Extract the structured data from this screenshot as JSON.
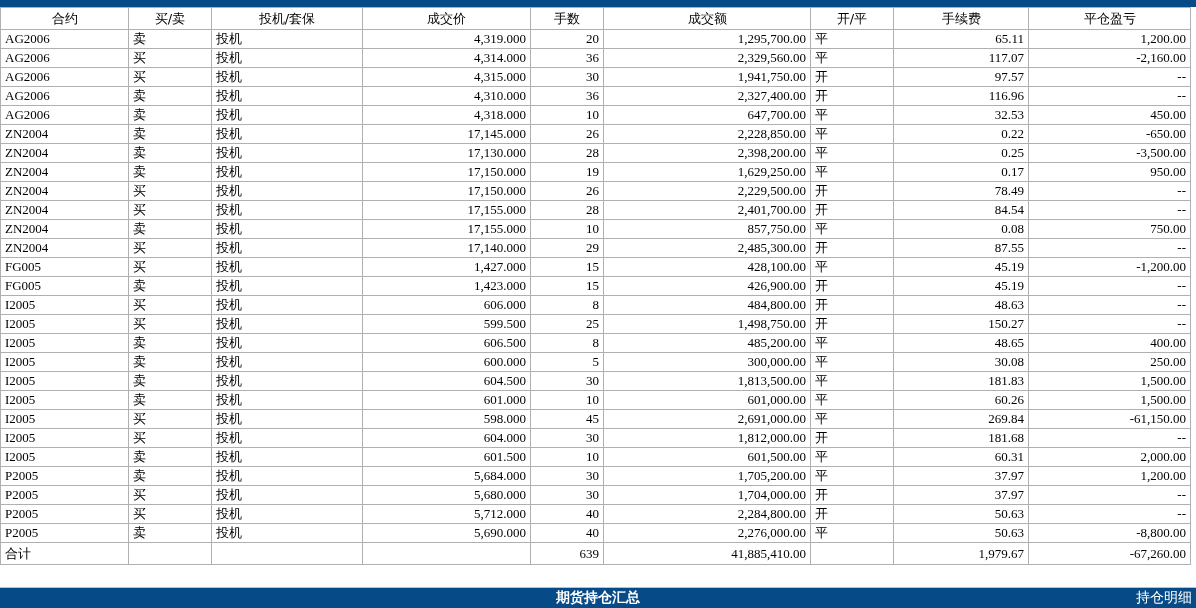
{
  "trades_table": {
    "columns": [
      "合约",
      "买/卖",
      "投机/套保",
      "成交价",
      "手数",
      "成交额",
      "开/平",
      "手续费",
      "平仓盈亏"
    ],
    "rows": [
      [
        "AG2006",
        "卖",
        "投机",
        "4,319.000",
        "20",
        "1,295,700.00",
        "平",
        "65.11",
        "1,200.00"
      ],
      [
        "AG2006",
        "买",
        "投机",
        "4,314.000",
        "36",
        "2,329,560.00",
        "平",
        "117.07",
        "-2,160.00"
      ],
      [
        "AG2006",
        "买",
        "投机",
        "4,315.000",
        "30",
        "1,941,750.00",
        "开",
        "97.57",
        "--"
      ],
      [
        "AG2006",
        "卖",
        "投机",
        "4,310.000",
        "36",
        "2,327,400.00",
        "开",
        "116.96",
        "--"
      ],
      [
        "AG2006",
        "卖",
        "投机",
        "4,318.000",
        "10",
        "647,700.00",
        "平",
        "32.53",
        "450.00"
      ],
      [
        "ZN2004",
        "卖",
        "投机",
        "17,145.000",
        "26",
        "2,228,850.00",
        "平",
        "0.22",
        "-650.00"
      ],
      [
        "ZN2004",
        "卖",
        "投机",
        "17,130.000",
        "28",
        "2,398,200.00",
        "平",
        "0.25",
        "-3,500.00"
      ],
      [
        "ZN2004",
        "卖",
        "投机",
        "17,150.000",
        "19",
        "1,629,250.00",
        "平",
        "0.17",
        "950.00"
      ],
      [
        "ZN2004",
        "买",
        "投机",
        "17,150.000",
        "26",
        "2,229,500.00",
        "开",
        "78.49",
        "--"
      ],
      [
        "ZN2004",
        "买",
        "投机",
        "17,155.000",
        "28",
        "2,401,700.00",
        "开",
        "84.54",
        "--"
      ],
      [
        "ZN2004",
        "卖",
        "投机",
        "17,155.000",
        "10",
        "857,750.00",
        "平",
        "0.08",
        "750.00"
      ],
      [
        "ZN2004",
        "买",
        "投机",
        "17,140.000",
        "29",
        "2,485,300.00",
        "开",
        "87.55",
        "--"
      ],
      [
        "FG005",
        "买",
        "投机",
        "1,427.000",
        "15",
        "428,100.00",
        "平",
        "45.19",
        "-1,200.00"
      ],
      [
        "FG005",
        "卖",
        "投机",
        "1,423.000",
        "15",
        "426,900.00",
        "开",
        "45.19",
        "--"
      ],
      [
        "I2005",
        "买",
        "投机",
        "606.000",
        "8",
        "484,800.00",
        "开",
        "48.63",
        "--"
      ],
      [
        "I2005",
        "买",
        "投机",
        "599.500",
        "25",
        "1,498,750.00",
        "开",
        "150.27",
        "--"
      ],
      [
        "I2005",
        "卖",
        "投机",
        "606.500",
        "8",
        "485,200.00",
        "平",
        "48.65",
        "400.00"
      ],
      [
        "I2005",
        "卖",
        "投机",
        "600.000",
        "5",
        "300,000.00",
        "平",
        "30.08",
        "250.00"
      ],
      [
        "I2005",
        "卖",
        "投机",
        "604.500",
        "30",
        "1,813,500.00",
        "平",
        "181.83",
        "1,500.00"
      ],
      [
        "I2005",
        "卖",
        "投机",
        "601.000",
        "10",
        "601,000.00",
        "平",
        "60.26",
        "1,500.00"
      ],
      [
        "I2005",
        "买",
        "投机",
        "598.000",
        "45",
        "2,691,000.00",
        "平",
        "269.84",
        "-61,150.00"
      ],
      [
        "I2005",
        "买",
        "投机",
        "604.000",
        "30",
        "1,812,000.00",
        "开",
        "181.68",
        "--"
      ],
      [
        "I2005",
        "卖",
        "投机",
        "601.500",
        "10",
        "601,500.00",
        "平",
        "60.31",
        "2,000.00"
      ],
      [
        "P2005",
        "卖",
        "投机",
        "5,684.000",
        "30",
        "1,705,200.00",
        "平",
        "37.97",
        "1,200.00"
      ],
      [
        "P2005",
        "买",
        "投机",
        "5,680.000",
        "30",
        "1,704,000.00",
        "开",
        "37.97",
        "--"
      ],
      [
        "P2005",
        "买",
        "投机",
        "5,712.000",
        "40",
        "2,284,800.00",
        "开",
        "50.63",
        "--"
      ],
      [
        "P2005",
        "卖",
        "投机",
        "5,690.000",
        "40",
        "2,276,000.00",
        "平",
        "50.63",
        "-8,800.00"
      ]
    ],
    "total": {
      "label": "合计",
      "lots": "639",
      "amount": "41,885,410.00",
      "fee": "1,979.67",
      "pnl": "-67,260.00"
    }
  },
  "positions_bar": {
    "title": "期货持仓汇总",
    "link": "持仓明细"
  }
}
